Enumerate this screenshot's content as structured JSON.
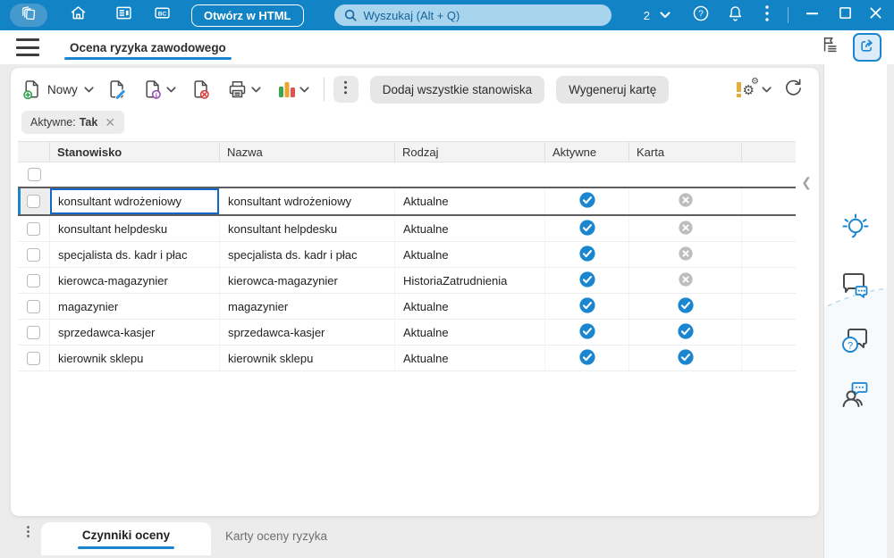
{
  "titlebar": {
    "open_in_html": "Otwórz w HTML",
    "search_placeholder": "Wyszukaj (Alt + Q)",
    "user_badge": "2"
  },
  "tabbar": {
    "active_tab": "Ocena ryzyka zawodowego"
  },
  "toolbar": {
    "new": "Nowy",
    "add_all": "Dodaj wszystkie stanowiska",
    "generate_card": "Wygeneruj kartę"
  },
  "filter_chip": {
    "label": "Aktywne:",
    "value": "Tak"
  },
  "table": {
    "columns": {
      "stanowisko": "Stanowisko",
      "nazwa": "Nazwa",
      "rodzaj": "Rodzaj",
      "aktywne": "Aktywne",
      "karta": "Karta"
    },
    "rows": [
      {
        "stanowisko": "konsultant wdrożeniowy",
        "nazwa": "konsultant wdrożeniowy",
        "rodzaj": "Aktualne",
        "aktywne": true,
        "karta": false
      },
      {
        "stanowisko": "konsultant helpdesku",
        "nazwa": "konsultant helpdesku",
        "rodzaj": "Aktualne",
        "aktywne": true,
        "karta": false
      },
      {
        "stanowisko": "specjalista ds. kadr i płac",
        "nazwa": "specjalista ds. kadr i płac",
        "rodzaj": "Aktualne",
        "aktywne": true,
        "karta": false
      },
      {
        "stanowisko": "kierowca-magazynier",
        "nazwa": "kierowca-magazynier",
        "rodzaj": "HistoriaZatrudnienia",
        "aktywne": true,
        "karta": false
      },
      {
        "stanowisko": "magazynier",
        "nazwa": "magazynier",
        "rodzaj": "Aktualne",
        "aktywne": true,
        "karta": true
      },
      {
        "stanowisko": "sprzedawca-kasjer",
        "nazwa": "sprzedawca-kasjer",
        "rodzaj": "Aktualne",
        "aktywne": true,
        "karta": true
      },
      {
        "stanowisko": "kierownik sklepu",
        "nazwa": "kierownik sklepu",
        "rodzaj": "Aktualne",
        "aktywne": true,
        "karta": true
      }
    ]
  },
  "bottom_tabs": {
    "active": "Czynniki oceny",
    "inactive": "Karty oceny ryzyka"
  },
  "colors": {
    "titlebar_blue": "#1283c5",
    "accent_blue": "#1a86d0",
    "status_active": "#1a86d0",
    "status_inactive": "#bdbdbd"
  }
}
